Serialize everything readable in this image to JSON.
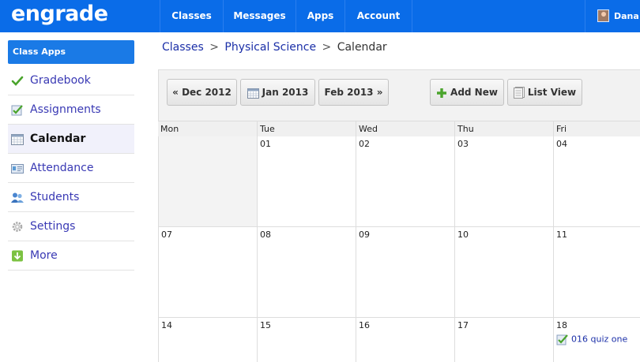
{
  "brand": {
    "logo": "engrade"
  },
  "nav": {
    "items": [
      "Classes",
      "Messages",
      "Apps",
      "Account"
    ]
  },
  "user": {
    "name": "Dana L"
  },
  "sidebar": {
    "header": "Class Apps",
    "items": [
      {
        "label": "Gradebook",
        "icon": "checkmark-icon"
      },
      {
        "label": "Assignments",
        "icon": "assignment-check-icon"
      },
      {
        "label": "Calendar",
        "icon": "calendar-icon",
        "active": true
      },
      {
        "label": "Attendance",
        "icon": "attendance-icon"
      },
      {
        "label": "Students",
        "icon": "students-icon"
      },
      {
        "label": "Settings",
        "icon": "gear-icon"
      },
      {
        "label": "More",
        "icon": "arrow-down-icon"
      }
    ]
  },
  "breadcrumb": {
    "root": "Classes",
    "class": "Physical Science",
    "current": "Calendar",
    "separator": ">"
  },
  "toolbar": {
    "prev": "« Dec 2012",
    "current": "Jan 2013",
    "next": "Feb 2013 »",
    "add": "Add New",
    "list": "List View"
  },
  "calendar": {
    "days": [
      "Mon",
      "Tue",
      "Wed",
      "Thu",
      "Fri"
    ],
    "rows": [
      [
        "",
        "01",
        "02",
        "03",
        "04"
      ],
      [
        "07",
        "08",
        "09",
        "10",
        "11"
      ],
      [
        "14",
        "15",
        "16",
        "17",
        "18"
      ]
    ],
    "events": [
      {
        "day": "18",
        "title": "016 quiz one"
      }
    ]
  },
  "colors": {
    "topbar": "#0a6ce8",
    "link": "#1b2fa8",
    "sidebar_link": "#3939b4"
  }
}
